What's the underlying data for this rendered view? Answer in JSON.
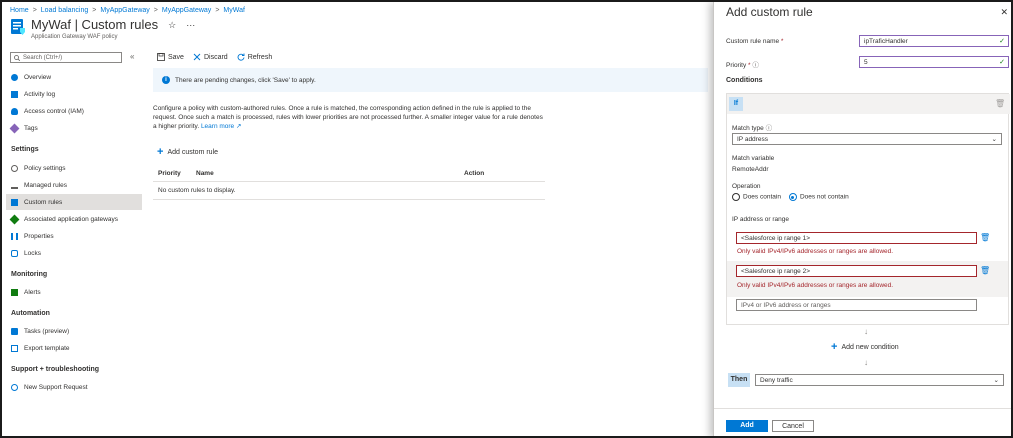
{
  "breadcrumb": [
    "Home",
    "Load balancing",
    "MyAppGateway",
    "MyAppGateway",
    "MyWaf"
  ],
  "breadcrumb_sep": ">",
  "header": {
    "title": "MyWaf | Custom rules",
    "subtitle": "Application Gateway WAF policy",
    "star": "☆",
    "more": "···"
  },
  "nav": {
    "search_placeholder": "Search (Ctrl+/)",
    "collapse": "«",
    "items_top": [
      {
        "label": "Overview",
        "icon": "overview-icon",
        "color": "#0078d4"
      },
      {
        "label": "Activity log",
        "icon": "activity-log-icon",
        "color": "#0078d4"
      },
      {
        "label": "Access control (IAM)",
        "icon": "iam-icon",
        "color": "#0078d4"
      },
      {
        "label": "Tags",
        "icon": "tag-icon",
        "color": "#8764b8"
      }
    ],
    "settings_header": "Settings",
    "settings_items": [
      {
        "label": "Policy settings",
        "icon": "gear-icon",
        "color": "#605e5c"
      },
      {
        "label": "Managed rules",
        "icon": "managed-rules-icon",
        "color": "#605e5c"
      },
      {
        "label": "Custom rules",
        "icon": "custom-rules-icon",
        "color": "#0078d4",
        "active": true
      },
      {
        "label": "Associated application gateways",
        "icon": "app-gateway-icon",
        "color": "#107c10"
      },
      {
        "label": "Properties",
        "icon": "properties-icon",
        "color": "#0078d4"
      },
      {
        "label": "Locks",
        "icon": "lock-icon",
        "color": "#0078d4"
      }
    ],
    "monitoring_header": "Monitoring",
    "monitoring_items": [
      {
        "label": "Alerts",
        "icon": "alerts-icon",
        "color": "#107c10"
      }
    ],
    "automation_header": "Automation",
    "automation_items": [
      {
        "label": "Tasks (preview)",
        "icon": "tasks-icon",
        "color": "#0078d4"
      },
      {
        "label": "Export template",
        "icon": "export-template-icon",
        "color": "#0078d4"
      }
    ],
    "support_header": "Support + troubleshooting",
    "support_items": [
      {
        "label": "New Support Request",
        "icon": "support-icon",
        "color": "#0078d4"
      }
    ]
  },
  "toolbar": {
    "save": "Save",
    "discard": "Discard",
    "refresh": "Refresh"
  },
  "banner": {
    "text": "There are pending changes, click 'Save' to apply.",
    "icon": "i"
  },
  "description": {
    "text": "Configure a policy with custom-authored rules. Once a rule is matched, the corresponding action defined in the rule is applied to the request. Once such a match is processed, rules with lower priorities are not processed further. A smaller integer value for a rule denotes a higher priority.",
    "link": "Learn more ↗"
  },
  "add_custom_rule": "Add custom rule",
  "table": {
    "headers": [
      "Priority",
      "Name",
      "Action"
    ],
    "empty": "No custom rules to display."
  },
  "panel": {
    "title": "Add custom rule",
    "close": "✕",
    "rule_name_label": "Custom rule name",
    "rule_name_value": "ipTraficHandler",
    "priority_label": "Priority",
    "priority_value": "5",
    "conditions_label": "Conditions",
    "if_label": "If",
    "match_type_label": "Match type",
    "match_type_value": "IP address",
    "match_variable_label": "Match variable",
    "match_variable_value": "RemoteAddr",
    "operation_label": "Operation",
    "op_contains": "Does contain",
    "op_not_contains": "Does not contain",
    "ip_range_label": "IP address or range",
    "ip_ranges": [
      {
        "value": "<Salesforce ip range 1>",
        "error": "Only valid IPv4/IPv6 addresses or ranges are allowed."
      },
      {
        "value": "<Salesforce ip range 2>",
        "error": "Only valid IPv4/IPv6 addresses or ranges are allowed."
      }
    ],
    "ip_placeholder": "IPv4 or IPv6 address or ranges",
    "add_condition": "Add new condition",
    "then_label": "Then",
    "then_value": "Deny traffic",
    "add_button": "Add",
    "cancel_button": "Cancel",
    "required_mark": "*",
    "info_mark": "ⓘ",
    "check_mark": "✓",
    "chevron": "⌄",
    "trash": "🗑",
    "arrow": "↓"
  },
  "colors": {
    "accent": "#0078d4",
    "error": "#a4262c",
    "focus": "#8764b8",
    "success": "#107c10"
  }
}
